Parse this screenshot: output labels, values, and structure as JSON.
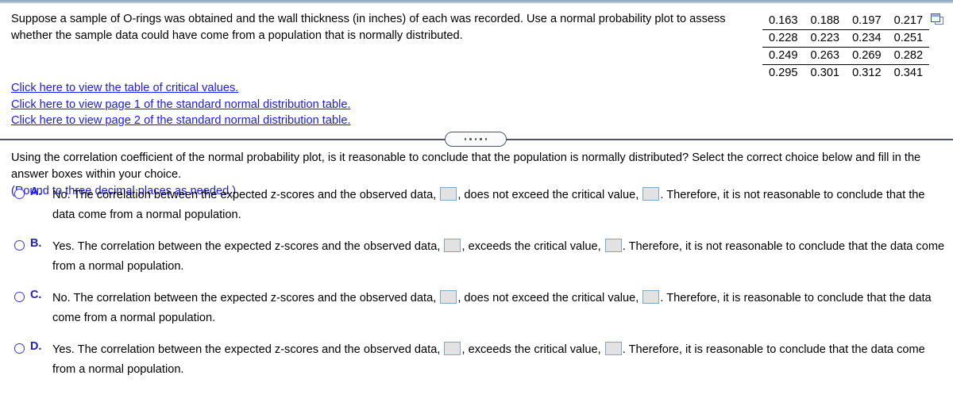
{
  "problem": {
    "stem": "Suppose a sample of O-rings was obtained and the wall thickness (in inches) of each was recorded. Use a normal probability plot to assess whether the sample data could have come from a population that is normally distributed."
  },
  "data_table": {
    "icon": "popout-window-icon",
    "rows": [
      [
        "0.163",
        "0.188",
        "0.197",
        "0.217"
      ],
      [
        "0.228",
        "0.223",
        "0.234",
        "0.251"
      ],
      [
        "0.249",
        "0.263",
        "0.269",
        "0.282"
      ],
      [
        "0.295",
        "0.301",
        "0.312",
        "0.341"
      ]
    ]
  },
  "links": [
    {
      "label": "Click here to view the table of critical values."
    },
    {
      "label": "Click here to view page 1 of the standard normal distribution table."
    },
    {
      "label": "Click here to view page 2 of the standard normal distribution table."
    }
  ],
  "divider": {
    "dots": 5
  },
  "prompt": {
    "question": "Using the correlation coefficient of the normal probability plot, is it reasonable to conclude that the population is normally distributed? Select the correct choice below and fill in the answer boxes within your choice.",
    "rounding": "(Round to three decimal places as needed.)"
  },
  "choices": [
    {
      "letter": "A.",
      "selected": false,
      "seg1": "No. The correlation between the expected z-scores and the observed data,",
      "box1": "",
      "seg2": ", does not exceed the critical value,",
      "box2": "",
      "seg3": ". Therefore, it is not reasonable to conclude that the data come from a normal population."
    },
    {
      "letter": "B.",
      "selected": false,
      "seg1": "Yes. The correlation between the expected z-scores and the observed data,",
      "box1": "",
      "seg2": ", exceeds the critical value,",
      "box2": "",
      "seg3": ". Therefore, it is not reasonable to conclude that the data come from a normal population."
    },
    {
      "letter": "C.",
      "selected": false,
      "seg1": "No. The correlation between the expected z-scores and the observed data,",
      "box1": "",
      "seg2": ", does not exceed the critical value,",
      "box2": "",
      "seg3": ". Therefore, it is reasonable to conclude that the data come from a normal population."
    },
    {
      "letter": "D.",
      "selected": false,
      "seg1": "Yes. The correlation between the expected z-scores and the observed data,",
      "box1": "",
      "seg2": ", exceeds the critical value,",
      "box2": "",
      "seg3": ". Therefore, it is reasonable to conclude that the data come from a normal population."
    }
  ],
  "colors": {
    "link": "#1a1af0",
    "accent": "#2020c8",
    "rule": "#4a5568",
    "answer_box_fill": "#e2e2e2",
    "answer_box_border": "#7ea8c4"
  }
}
